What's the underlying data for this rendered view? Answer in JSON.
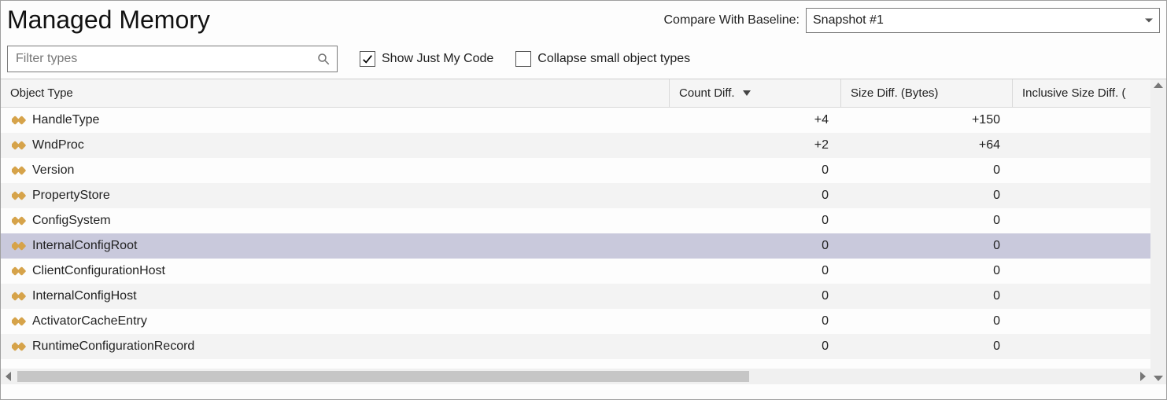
{
  "header": {
    "title": "Managed Memory",
    "compare_label": "Compare With Baseline:",
    "compare_value": "Snapshot #1"
  },
  "toolbar": {
    "filter_placeholder": "Filter types",
    "show_just_my_code": {
      "label": "Show Just My Code",
      "checked": true
    },
    "collapse_small": {
      "label": "Collapse small object types",
      "checked": false
    }
  },
  "columns": [
    {
      "key": "name",
      "label": "Object Type",
      "sorted": false
    },
    {
      "key": "count_diff",
      "label": "Count Diff.",
      "sorted": true,
      "direction": "desc"
    },
    {
      "key": "size_diff",
      "label": "Size Diff. (Bytes)",
      "sorted": false
    },
    {
      "key": "inclusive_size_diff",
      "label": "Inclusive Size Diff. (",
      "sorted": false
    }
  ],
  "rows": [
    {
      "name": "HandleType",
      "count_diff": "+4",
      "size_diff": "+150",
      "inclusive_size_diff": "",
      "selected": false
    },
    {
      "name": "WndProc",
      "count_diff": "+2",
      "size_diff": "+64",
      "inclusive_size_diff": "",
      "selected": false
    },
    {
      "name": "Version",
      "count_diff": "0",
      "size_diff": "0",
      "inclusive_size_diff": "",
      "selected": false
    },
    {
      "name": "PropertyStore",
      "count_diff": "0",
      "size_diff": "0",
      "inclusive_size_diff": "",
      "selected": false
    },
    {
      "name": "ConfigSystem",
      "count_diff": "0",
      "size_diff": "0",
      "inclusive_size_diff": "",
      "selected": false
    },
    {
      "name": "InternalConfigRoot",
      "count_diff": "0",
      "size_diff": "0",
      "inclusive_size_diff": "",
      "selected": true
    },
    {
      "name": "ClientConfigurationHost",
      "count_diff": "0",
      "size_diff": "0",
      "inclusive_size_diff": "",
      "selected": false
    },
    {
      "name": "InternalConfigHost",
      "count_diff": "0",
      "size_diff": "0",
      "inclusive_size_diff": "",
      "selected": false
    },
    {
      "name": "ActivatorCacheEntry",
      "count_diff": "0",
      "size_diff": "0",
      "inclusive_size_diff": "",
      "selected": false
    },
    {
      "name": "RuntimeConfigurationRecord",
      "count_diff": "0",
      "size_diff": "0",
      "inclusive_size_diff": "",
      "selected": false
    }
  ]
}
